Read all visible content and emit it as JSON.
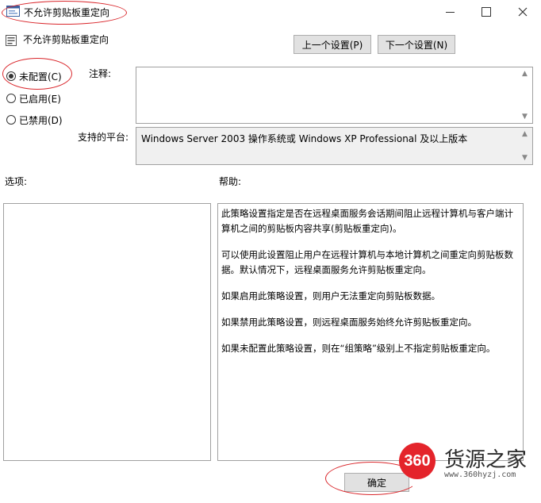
{
  "window": {
    "title": "不允许剪贴板重定向",
    "minimize_icon": "minimize-icon",
    "maximize_icon": "maximize-icon",
    "close_icon": "close-icon"
  },
  "header": {
    "policy_name": "不允许剪贴板重定向",
    "prev_button": "上一个设置(P)",
    "next_button": "下一个设置(N)"
  },
  "state": {
    "options": [
      {
        "label": "未配置(C)",
        "checked": true
      },
      {
        "label": "已启用(E)",
        "checked": false
      },
      {
        "label": "已禁用(D)",
        "checked": false
      }
    ]
  },
  "comment": {
    "label": "注释:",
    "value": ""
  },
  "platform": {
    "label": "支持的平台:",
    "value": "Windows Server 2003 操作系统或 Windows XP Professional 及以上版本"
  },
  "options_section": {
    "label": "选项:"
  },
  "help_section": {
    "label": "帮助:",
    "paragraphs": [
      "此策略设置指定是否在远程桌面服务会话期间阻止远程计算机与客户端计算机之间的剪贴板内容共享(剪贴板重定向)。",
      "可以使用此设置阻止用户在远程计算机与本地计算机之间重定向剪贴板数据。默认情况下，远程桌面服务允许剪贴板重定向。",
      "如果启用此策略设置，则用户无法重定向剪贴板数据。",
      "如果禁用此策略设置，则远程桌面服务始终允许剪贴板重定向。",
      "如果未配置此策略设置，则在“组策略”级别上不指定剪贴板重定向。"
    ]
  },
  "footer": {
    "ok_button": "确定"
  },
  "watermark": {
    "logo_number": "360",
    "brand": "货源之家",
    "url": "www.360hyzj.com"
  },
  "colors": {
    "annotation_red": "#d9262b",
    "logo_red": "#e4242b"
  }
}
